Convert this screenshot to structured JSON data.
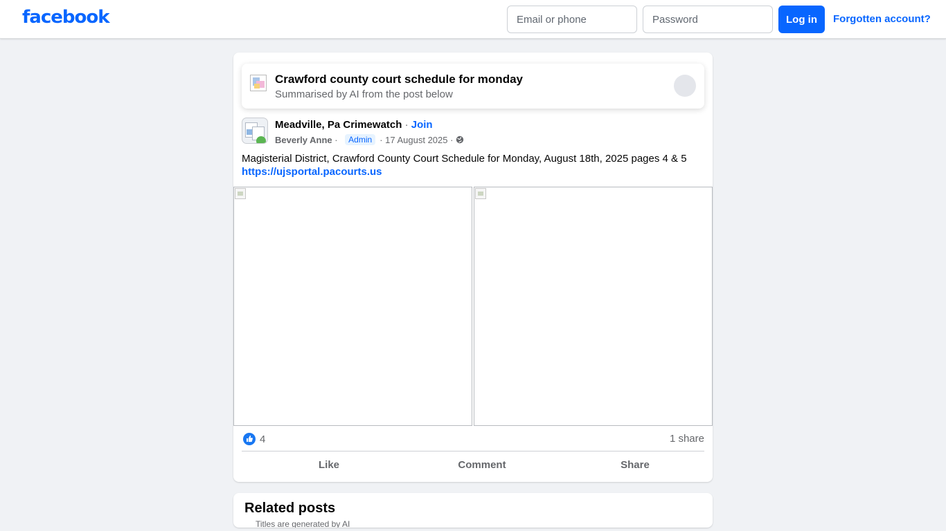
{
  "header": {
    "logo": "facebook",
    "email_placeholder": "Email or phone",
    "password_placeholder": "Password",
    "login_label": "Log in",
    "forgot_label": "Forgotten account?"
  },
  "ai_summary": {
    "title": "Crawford county court schedule for monday",
    "subtitle": "Summarised by AI from the post below"
  },
  "post": {
    "group_name": "Meadville, Pa Crimewatch",
    "separator": " · ",
    "join_label": "Join",
    "author": "Beverly Anne",
    "author_sep": " · ",
    "role_badge": "Admin",
    "date": "· 17 August 2025 ·",
    "text": "Magisterial District, Crawford County Court Schedule for Monday, August 18th, 2025 pages 4 &  5",
    "link": "https://ujsportal.pacourts.us",
    "like_count": "4",
    "share_count": "1 share",
    "actions": {
      "like": "Like",
      "comment": "Comment",
      "share": "Share"
    }
  },
  "related": {
    "title": "Related posts",
    "subtitle": "Titles are generated by AI"
  },
  "colors": {
    "brand": "#0866ff",
    "background": "#f0f2f5",
    "muted_text": "#65676b"
  }
}
